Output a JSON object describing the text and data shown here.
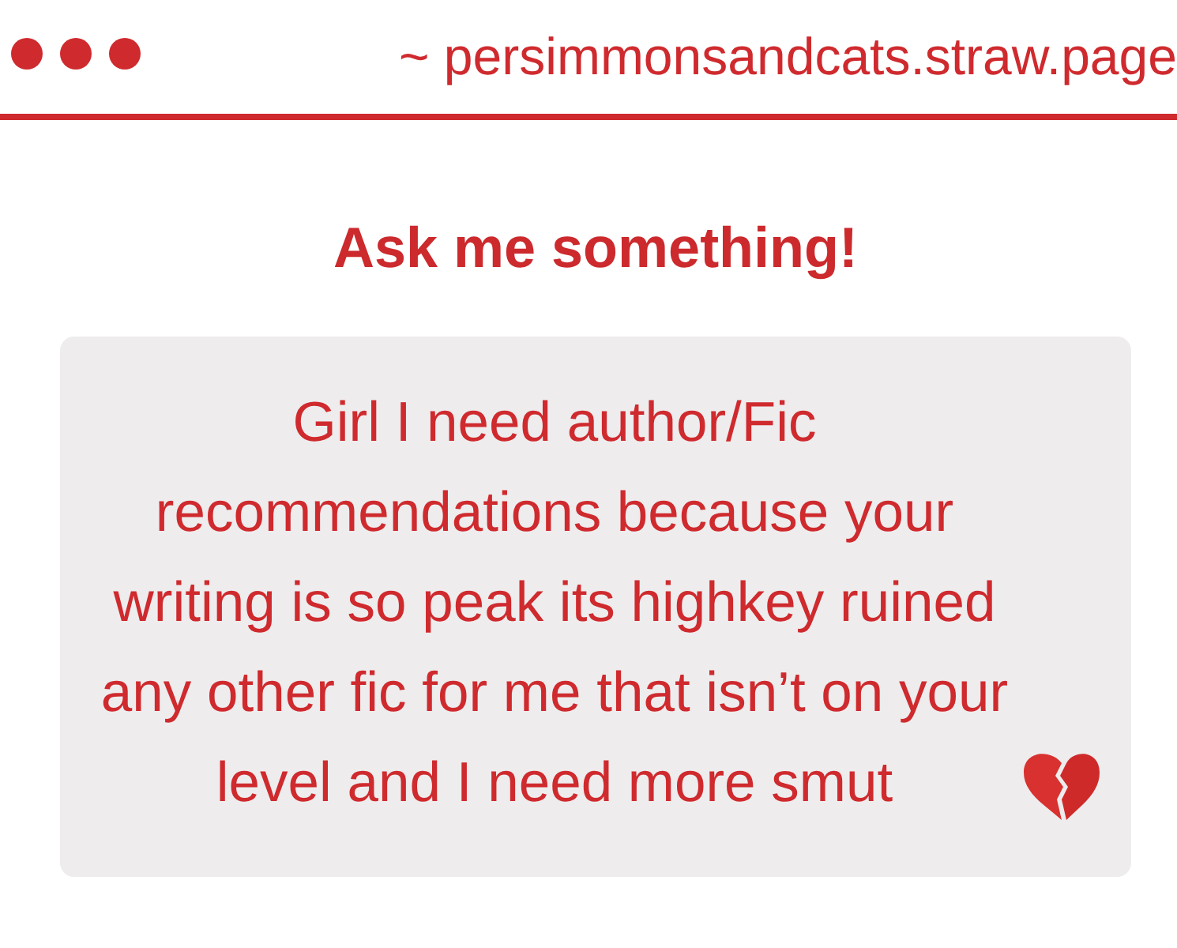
{
  "window": {
    "url": "~ persimmonsandcats.straw.page"
  },
  "page": {
    "title": "Ask me something!"
  },
  "question": {
    "text": "Girl I need author/Fic recommendations because your writing is so peak its highkey ruined any other fic for me that isn’t on your level and I need more smut"
  }
}
